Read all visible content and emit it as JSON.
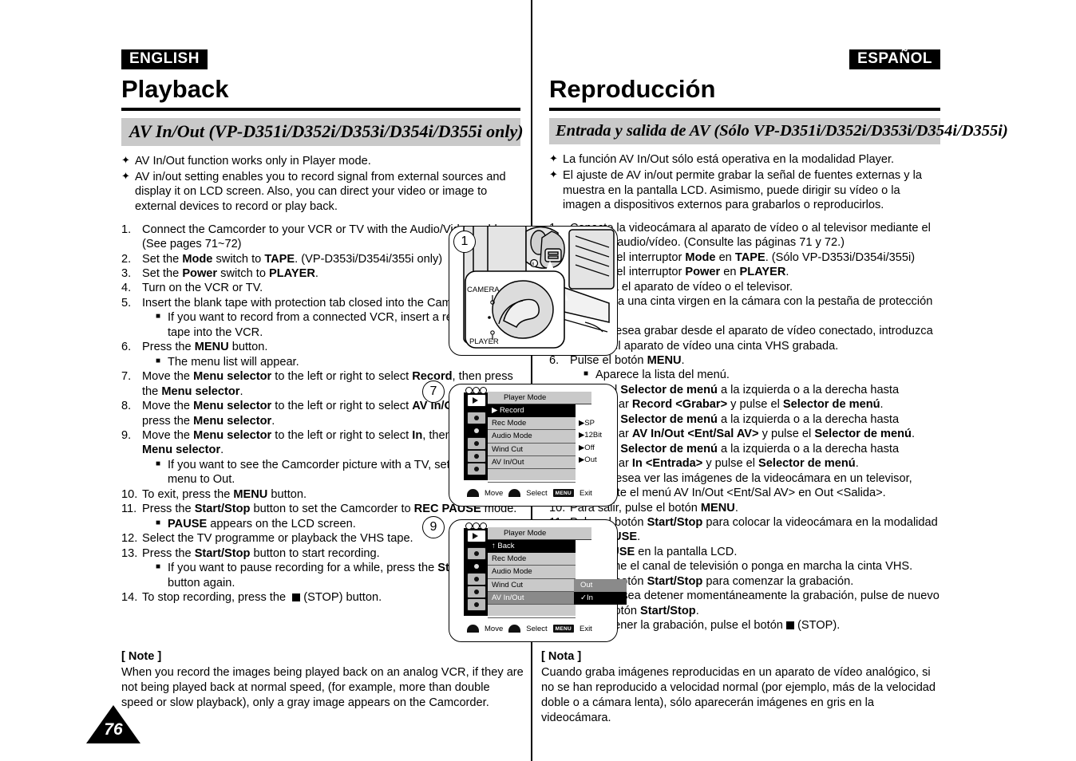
{
  "left": {
    "lang_tag": "ENGLISH",
    "title": "Playback",
    "section_band": "AV In/Out (VP-D351i/D352i/D353i/D354i/D355i only)",
    "intro": [
      "AV In/Out function works only in Player mode.",
      "AV in/out setting enables you to record signal from external sources and display it on LCD screen. Also, you can direct your video or image to external devices to record or play back."
    ],
    "steps": [
      {
        "n": "1.",
        "text": "Connect the Camcorder to your VCR or TV with the Audio/Video cable. (See pages 71~72)"
      },
      {
        "n": "2.",
        "text": "Set the <b>Mode</b> switch to <b>TAPE</b>. (VP-D353i/D354i/355i only)"
      },
      {
        "n": "3.",
        "text": "Set the <b>Power</b> switch to <b>PLAYER</b>."
      },
      {
        "n": "4.",
        "text": "Turn on the VCR or TV."
      },
      {
        "n": "5.",
        "text": "Insert the blank tape with protection tab closed into the Camcorder.",
        "subs": [
          "If you want to record from a connected VCR, insert a recorded VHS tape into the VCR."
        ]
      },
      {
        "n": "6.",
        "text": "Press the <b>MENU</b> button.",
        "subs": [
          "The menu list will appear."
        ]
      },
      {
        "n": "7.",
        "text": "Move the <b>Menu selector</b> to the left or right to select <b>Record</b>, then press the <b>Menu selector</b>."
      },
      {
        "n": "8.",
        "text": "Move the <b>Menu selector</b> to the left or right to select <b>AV In/Out</b>, then press the <b>Menu selector</b>."
      },
      {
        "n": "9.",
        "text": "Move the <b>Menu selector</b> to the left or right to select <b>In</b>, then press the <b>Menu selector</b>.",
        "subs": [
          "If you want to see the Camcorder picture with a TV, set AV In/Out menu to Out."
        ]
      },
      {
        "n": "10.",
        "text": "To exit, press the <b>MENU</b> button."
      },
      {
        "n": "11.",
        "text": "Press the <b>Start/Stop</b> button to set the Camcorder to <b>REC PAUSE</b> mode.",
        "subs": [
          "<b>PAUSE</b> appears on the LCD screen."
        ]
      },
      {
        "n": "12.",
        "text": "Select the TV programme or playback the VHS tape."
      },
      {
        "n": "13.",
        "text": "Press the <b>Start/Stop</b> button to start recording.",
        "subs": [
          "If you want to pause recording for a while, press the <b>Start/Stop</b> button again."
        ]
      },
      {
        "n": "14.",
        "text": "To stop recording, press the &nbsp;<span style=\"display:inline-block;width:10px;height:10px;background:#000;vertical-align:-1px;\"></span>&nbsp;(STOP) button."
      }
    ],
    "note_head": "[ Note ]",
    "note_body": "When you record the images being played back on an analog VCR, if they are not being played back at normal speed, (for example, more than double speed or slow playback), only a gray image appears on the Camcorder."
  },
  "right": {
    "lang_tag": "ESPAÑOL",
    "title": "Reproducción",
    "section_band": "Entrada y salida de AV  (Sólo VP-D351i/D352i/D353i/D354i/D355i)",
    "intro": [
      "La función AV In/Out sólo está operativa en la modalidad Player.",
      "El ajuste de AV in/out permite grabar la señal de fuentes externas y la muestra en la pantalla LCD. Asimismo, puede dirigir su vídeo o la imagen a dispositivos externos para grabarlos o reproducirlos."
    ],
    "steps": [
      {
        "n": "1.",
        "text": "Conecte la videocámara al aparato de vídeo o al televisor mediante el cable de audio/vídeo. (Consulte las páginas 71 y 72.)"
      },
      {
        "n": "2.",
        "text": "Coloque el interruptor <b>Mode</b> en <b>TAPE</b>. (Sólo VP-D353i/D354i/355i)"
      },
      {
        "n": "3.",
        "text": "Coloque el interruptor <b>Power</b> en <b>PLAYER</b>."
      },
      {
        "n": "4.",
        "text": "Encienda el aparato de vídeo o el televisor."
      },
      {
        "n": "5.",
        "text": "Introduzca una cinta virgen en la cámara con la pestaña de protección cerrada.",
        "subs": [
          "Si desea grabar desde el aparato de vídeo conectado, introduzca en el aparato de vídeo una cinta VHS grabada."
        ]
      },
      {
        "n": "6.",
        "text": "Pulse el botón <b>MENU</b>.",
        "subs": [
          "Aparece la lista del menú."
        ]
      },
      {
        "n": "7.",
        "text": "Mueva el <b>Selector de menú</b> a la izquierda o a la derecha hasta seleccionar <b>Record &lt;Grabar&gt;</b> y pulse el <b>Selector de menú</b>."
      },
      {
        "n": "8.",
        "text": "Mueva el <b>Selector de menú</b> a la izquierda o a la derecha hasta seleccionar <b>AV In/Out &lt;Ent/Sal AV&gt;</b> y pulse el <b>Selector de menú</b>."
      },
      {
        "n": "9.",
        "text": "Mueva el <b>Selector de menú</b> a la izquierda o a la derecha hasta seleccionar <b>In &lt;Entrada&gt;</b> y pulse el <b>Selector de menú</b>.",
        "subs": [
          "Si desea ver las imágenes de la videocámara en un televisor, ajuste el menú AV In/Out &lt;Ent/Sal AV&gt; en Out &lt;Salida&gt;."
        ]
      },
      {
        "n": "10.",
        "text": "Para salir, pulse el botón <b>MENU</b>."
      },
      {
        "n": "11.",
        "text": "Pulse el botón <b>Start/Stop</b> para colocar la videocámara en la modalidad <b>REC PAUSE</b>.",
        "subs": [
          "<b>PAUSE</b> en la pantalla LCD."
        ]
      },
      {
        "n": "12.",
        "text": "Seleccione el canal de televisión o ponga en marcha la cinta VHS."
      },
      {
        "n": "13.",
        "text": "Pulse el botón <b>Start/Stop</b> para comenzar la grabación.",
        "subs": [
          "Si desea detener momentáneamente la grabación, pulse de nuevo el botón <b>Start/Stop</b>."
        ]
      },
      {
        "n": "14.",
        "text": "Para detener la grabación, pulse el botón <span style=\"display:inline-block;width:10px;height:10px;background:#000;vertical-align:-1px;\"></span> (STOP)."
      }
    ],
    "note_head": "[ Nota ]",
    "note_body": "Cuando graba imágenes reproducidas en un aparato de vídeo analógico, si no se han reproducido a velocidad normal (por ejemplo, más de la velocidad doble o a cámara lenta), sólo aparecerán imágenes en gris en la videocámara."
  },
  "figures": {
    "fig1": {
      "callout": "1",
      "label_camera": "CAMERA",
      "label_player": "PLAYER"
    },
    "fig7": {
      "callout": "7",
      "header": "Player Mode",
      "rows": [
        {
          "label": "Record",
          "value": "",
          "state": "active",
          "marker": "▶"
        },
        {
          "label": "Rec Mode",
          "value": "SP"
        },
        {
          "label": "Audio Mode",
          "value": "12Bit"
        },
        {
          "label": "Wind Cut",
          "value": "Off"
        },
        {
          "label": "AV In/Out",
          "value": "Out"
        }
      ],
      "nav": {
        "move": "Move",
        "select": "Select",
        "menu_key": "MENU",
        "exit": "Exit"
      }
    },
    "fig9": {
      "callout": "9",
      "header": "Player Mode",
      "rows": [
        {
          "label": "Back",
          "state": "active",
          "marker": "↑"
        },
        {
          "label": "Rec Mode"
        },
        {
          "label": "Audio Mode"
        },
        {
          "label": "Wind Cut"
        },
        {
          "label": "AV In/Out",
          "state": "highlight"
        }
      ],
      "submenu": [
        {
          "label": "Out",
          "checked": false
        },
        {
          "label": "In",
          "checked": true
        }
      ],
      "nav": {
        "move": "Move",
        "select": "Select",
        "menu_key": "MENU",
        "exit": "Exit"
      }
    }
  },
  "page_number": "76"
}
